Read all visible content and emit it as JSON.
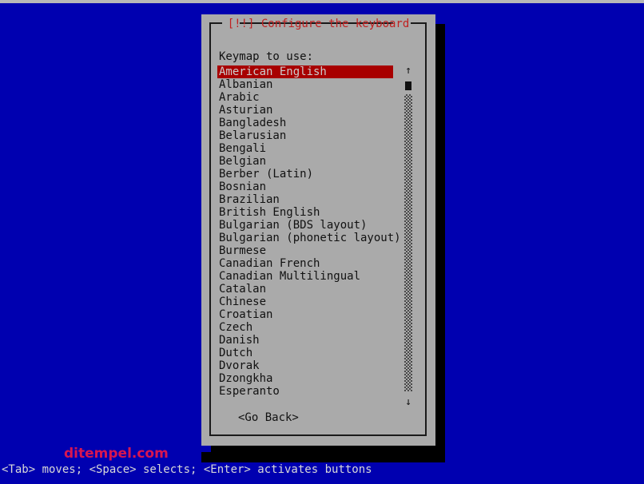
{
  "screen": {
    "background_color": "#0000b0",
    "watermark": "ditempel.com"
  },
  "dialog": {
    "title": "[!!] Configure the keyboard",
    "title_color": "#c02020",
    "panel_color": "#aaaaaa",
    "prompt": "Keymap to use:",
    "selected_index": 0,
    "items": [
      "American English",
      "Albanian",
      "Arabic",
      "Asturian",
      "Bangladesh",
      "Belarusian",
      "Bengali",
      "Belgian",
      "Berber (Latin)",
      "Bosnian",
      "Brazilian",
      "British English",
      "Bulgarian (BDS layout)",
      "Bulgarian (phonetic layout)",
      "Burmese",
      "Canadian French",
      "Canadian Multilingual",
      "Catalan",
      "Chinese",
      "Croatian",
      "Czech",
      "Danish",
      "Dutch",
      "Dvorak",
      "Dzongkha",
      "Esperanto"
    ],
    "scrollbar": {
      "up_arrow": "↑",
      "down_arrow": "↓"
    },
    "go_back_label": "<Go Back>"
  },
  "statusbar": {
    "text": "<Tab> moves; <Space> selects; <Enter> activates buttons"
  }
}
